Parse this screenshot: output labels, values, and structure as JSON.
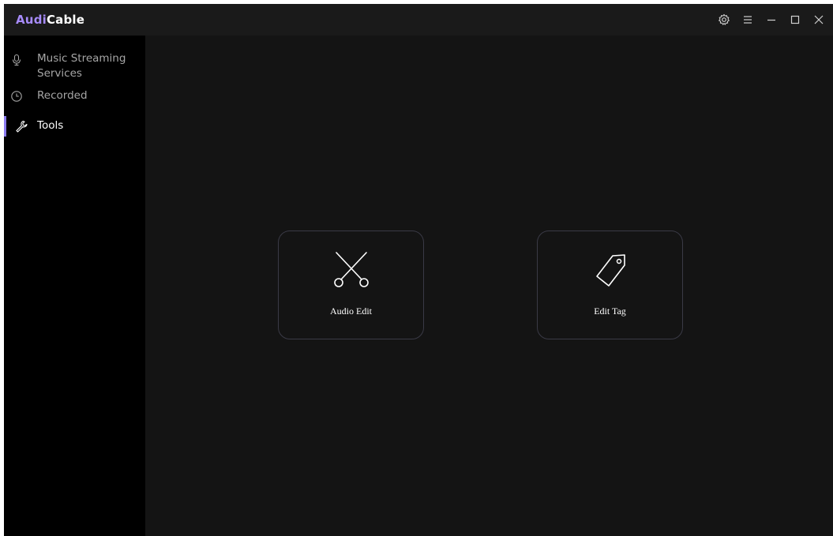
{
  "app": {
    "logo_part1": "Audi",
    "logo_part2": "Cable",
    "accent_color": "#8b7bf0"
  },
  "titlebar": {
    "controls": [
      {
        "icon": "gear-icon"
      },
      {
        "icon": "menu-icon"
      },
      {
        "icon": "minimize-icon"
      },
      {
        "icon": "maximize-icon"
      },
      {
        "icon": "close-icon"
      }
    ]
  },
  "sidebar": {
    "items": [
      {
        "label_line1": "Music Streaming",
        "label_line2": "Services",
        "icon": "microphone-icon",
        "active": false
      },
      {
        "label": "Recorded",
        "icon": "clock-icon",
        "active": false
      },
      {
        "label": "Tools",
        "icon": "wrench-icon",
        "active": true
      }
    ]
  },
  "main": {
    "tools": [
      {
        "label": "Audio Edit",
        "icon": "scissors-icon"
      },
      {
        "label": "Edit Tag",
        "icon": "tag-icon"
      }
    ]
  }
}
